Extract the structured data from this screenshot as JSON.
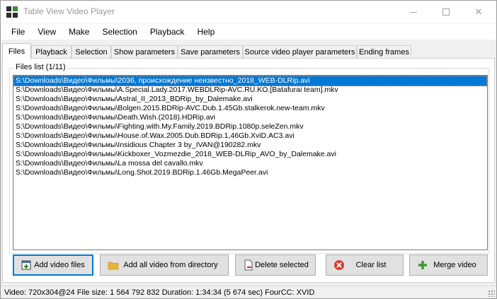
{
  "window": {
    "title": "Table View Video Player",
    "controls": {
      "minimize": "—",
      "maximize": "☐",
      "close": "✕"
    }
  },
  "menu": [
    "File",
    "View",
    "Make",
    "Selection",
    "Playback",
    "Help"
  ],
  "tabs": [
    "Files",
    "Playback",
    "Selection",
    "Show parameters",
    "Save parameters",
    "Source video player parameters",
    "Ending frames"
  ],
  "active_tab": "Files",
  "files_group": {
    "label": "Files list (1/11)",
    "selected_index": 0,
    "items": [
      "S:\\Downloads\\Видео\\Фильмы\\2036, происхождение неизвестно_2018_WEB-DLRip.avi",
      "S:\\Downloads\\Видео\\Фильмы\\A.Special.Lady.2017.WEBDLRip-AVC.RU.KO.[Batafurai team].mkv",
      "S:\\Downloads\\Видео\\Фильмы\\Astral_II_2013_BDRip_by_Dalemake.avi",
      "S:\\Downloads\\Видео\\Фильмы\\Bolgen.2015.BDRip-AVC.Dub.1.45Gb.stalkerok.new-team.mkv",
      "S:\\Downloads\\Видео\\Фильмы\\Death.Wish.(2018).HDRip.avi",
      "S:\\Downloads\\Видео\\Фильмы\\Fighting.with.My.Family.2019.BDRip.1080p.seleZen.mkv",
      "S:\\Downloads\\Видео\\Фильмы\\House.of.Wax.2005.Dub.BDRip.1,46Gb.XviD.AC3.avi",
      "S:\\Downloads\\Видео\\Фильмы\\Insidious Chapter 3 by_IVAN@190282.mkv",
      "S:\\Downloads\\Видео\\Фильмы\\Kickboxer_Vozmezdie_2018_WEB-DLRip_AVO_by_Dalemake.avi",
      "S:\\Downloads\\Видео\\Фильмы\\La mossa del cavallo.mkv",
      "S:\\Downloads\\Видео\\Фильмы\\Long.Shot.2019.BDRip.1.46Gb.MegaPeer.avi"
    ]
  },
  "buttons": {
    "add_video_files": "Add video files",
    "add_all_from_directory": "Add all video from directory",
    "delete_selected": "Delete selected",
    "clear_list": "Clear list",
    "merge_video": "Merge video"
  },
  "status": "Video: 720x304@24  File size: 1 564 792 832  Duration: 1:34:34 (5 674 sec)  FourCC: XVID",
  "colors": {
    "selection": "#0078d7",
    "clear_icon": "#e03a2e",
    "merge_icon": "#3c9a2e",
    "folder_icon": "#e8b53a"
  }
}
